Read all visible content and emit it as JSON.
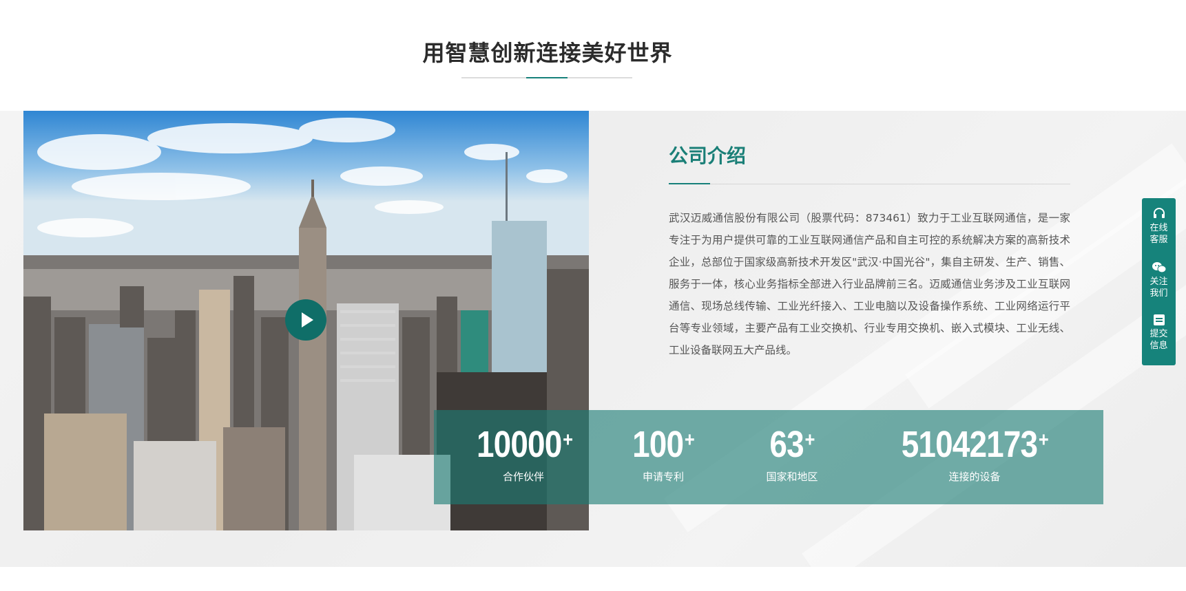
{
  "section": {
    "title": "用智慧创新连接美好世界"
  },
  "intro": {
    "title": "公司介绍",
    "text": "武汉迈威通信股份有限公司（股票代码：873461）致力于工业互联网通信，是一家专注于为用户提供可靠的工业互联网通信产品和自主可控的系统解决方案的高新技术企业，总部位于国家级高新技术开发区\"武汉·中国光谷\"，集自主研发、生产、销售、服务于一体，核心业务指标全部进入行业品牌前三名。迈威通信业务涉及工业互联网通信、现场总线传输、工业光纤接入、工业电脑以及设备操作系统、工业网络运行平台等专业领域，主要产品有工业交换机、行业专用交换机、嵌入式模块、工业无线、工业设备联网五大产品线。"
  },
  "stats": [
    {
      "value": "10000",
      "suffix": "+",
      "label": "合作伙伴"
    },
    {
      "value": "100",
      "suffix": "+",
      "label": "申请专利"
    },
    {
      "value": "63",
      "suffix": "+",
      "label": "国家和地区"
    },
    {
      "value": "51042173",
      "suffix": "+",
      "label": "连接的设备"
    }
  ],
  "side_panel": {
    "online_service": "在线客服",
    "follow_us": "关注我们",
    "submit_info": "提交信息"
  },
  "media": {
    "play_icon": "play-icon"
  },
  "colors": {
    "accent": "#16807a",
    "stats_bg": "#1c7c74",
    "side_panel": "#16837b"
  }
}
